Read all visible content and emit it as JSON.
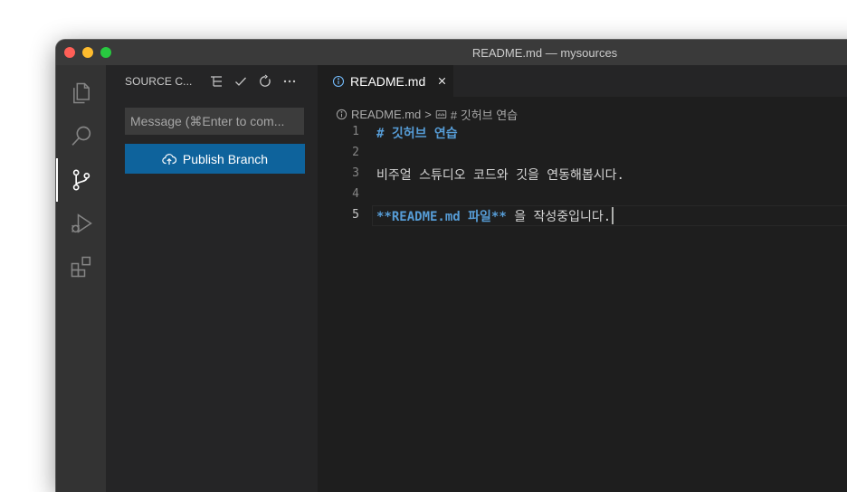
{
  "window": {
    "title": "README.md — mysources"
  },
  "activity_bar": {
    "items": [
      {
        "icon": "files-icon"
      },
      {
        "icon": "search-icon"
      },
      {
        "icon": "source-control-icon",
        "active": true
      },
      {
        "icon": "run-debug-icon"
      },
      {
        "icon": "extensions-icon"
      }
    ]
  },
  "sidebar": {
    "title": "SOURCE C...",
    "actions": [
      "tree-view-icon",
      "check-icon",
      "refresh-icon",
      "more-icon"
    ],
    "commit_placeholder": "Message (⌘Enter to com...",
    "publish_label": "Publish Branch"
  },
  "editor": {
    "tab": {
      "label": "README.md"
    },
    "breadcrumb": {
      "file": "README.md",
      "separator": ">",
      "symbol": "# 깃허브 연습"
    },
    "lines": [
      {
        "number": "1",
        "heading": "# 깃허브 연습"
      },
      {
        "number": "2",
        "text": ""
      },
      {
        "number": "3",
        "text": "비주얼 스튜디오 코드와 깃을 연동해봅시다."
      },
      {
        "number": "4",
        "text": ""
      },
      {
        "number": "5",
        "bold": "**README.md 파일**",
        "rest": " 을 작성중입니다."
      }
    ]
  },
  "colors": {
    "accent": "#0e639c",
    "editor_bg": "#1e1e1e",
    "sidebar_bg": "#252526",
    "activity_bg": "#333333",
    "markdown_keyword": "#569cd6"
  }
}
